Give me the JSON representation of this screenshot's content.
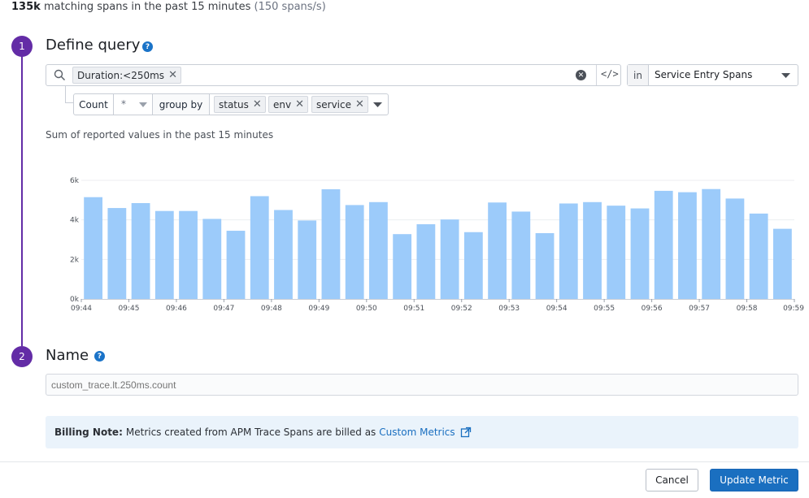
{
  "summary": {
    "count": "135k",
    "text": "matching spans in the past 15 minutes",
    "rate": "(150 spans/s)"
  },
  "step1": {
    "number": "1",
    "title": "Define query",
    "help_icon": "question-circle-icon"
  },
  "search": {
    "icon": "search-icon",
    "filter_tag": "Duration:<250ms",
    "clear_icon": "clear-circle-icon",
    "code_toggle_icon": "code-icon",
    "code_toggle_label": "</>",
    "in_label": "in",
    "span_type": "Service Entry Spans"
  },
  "aggregation": {
    "measure": "Count",
    "field": "*",
    "group_by_label": "group by",
    "group_tags": [
      "status",
      "env",
      "service"
    ]
  },
  "chart_caption": "Sum of reported values in the past 15 minutes",
  "chart_data": {
    "type": "bar",
    "y_ticks": [
      "0k",
      "2k",
      "4k",
      "6k"
    ],
    "ylim": [
      0,
      6000
    ],
    "x_ticks": [
      "09:44",
      "09:45",
      "09:46",
      "09:47",
      "09:48",
      "09:49",
      "09:50",
      "09:51",
      "09:52",
      "09:53",
      "09:54",
      "09:55",
      "09:56",
      "09:57",
      "09:58",
      "09:59"
    ],
    "values": [
      5150,
      4600,
      4850,
      4450,
      4450,
      4050,
      3450,
      5200,
      4500,
      3970,
      5550,
      4750,
      4900,
      3280,
      3780,
      4020,
      3380,
      4880,
      4420,
      3330,
      4830,
      4900,
      4720,
      4580,
      5470,
      5400,
      5560,
      5080,
      4320,
      3550
    ],
    "grid": true,
    "bar_color": "#9ccbfa"
  },
  "step2": {
    "number": "2",
    "title": "Name",
    "help_icon": "question-circle-icon"
  },
  "name_input": {
    "placeholder": "custom_trace.lt.250ms.count"
  },
  "billing": {
    "label": "Billing Note:",
    "text": "Metrics created from APM Trace Spans are billed as",
    "link": "Custom Metrics",
    "link_icon": "external-link-icon"
  },
  "buttons": {
    "cancel": "Cancel",
    "update": "Update Metric"
  },
  "colors": {
    "accent": "#632ca6",
    "primary": "#1a6fc0",
    "bar": "#9ccbfa"
  }
}
